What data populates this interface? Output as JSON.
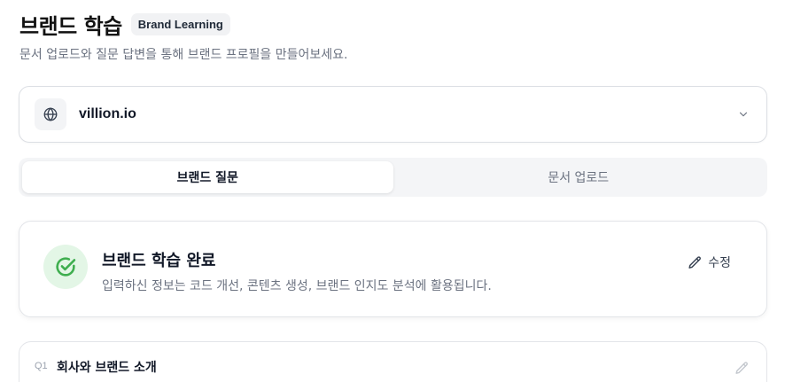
{
  "header": {
    "title": "브랜드 학습",
    "badge": "Brand Learning",
    "subtitle": "문서 업로드와 질문 답변을 통해 브랜드 프로필을 만들어보세요."
  },
  "site_selector": {
    "icon": "globe-icon",
    "value": "villion.io",
    "chevron_icon": "chevron-down-icon"
  },
  "tabs": [
    {
      "label": "브랜드 질문",
      "active": true
    },
    {
      "label": "문서 업로드",
      "active": false
    }
  ],
  "status_card": {
    "icon": "check-circle-icon",
    "title": "브랜드 학습 완료",
    "description": "입력하신 정보는 코드 개선, 콘텐츠 생성, 브랜드 인지도 분석에 활용됩니다.",
    "edit_label": "수정",
    "accent_color": "#3fae4f"
  },
  "questions": [
    {
      "number": "Q1",
      "title": "회사와 브랜드 소개"
    }
  ]
}
